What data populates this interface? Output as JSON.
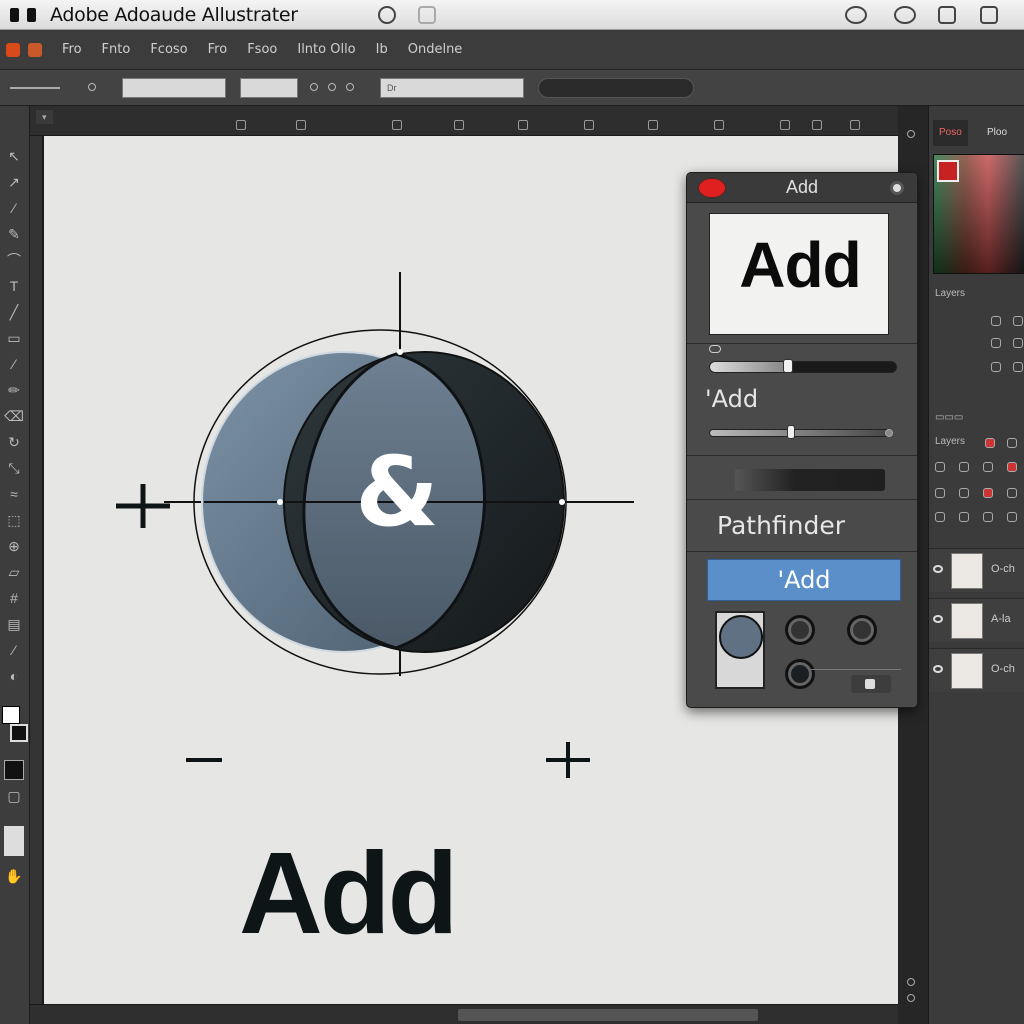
{
  "window": {
    "title": "Adobe Adoaude Allustrater"
  },
  "menu": {
    "items": [
      "Fro",
      "Fnto",
      "Fcoso",
      "Fro",
      "Fsoo",
      "Ilnto Ollo",
      "Ib",
      "Ondelne"
    ]
  },
  "controlbar": {
    "field_1": "",
    "field_2": "",
    "field_3": "Dr"
  },
  "canvas": {
    "ampersand": "&",
    "label": "Add",
    "minus": "-",
    "plus": "+"
  },
  "pathfinder_panel": {
    "title": "Add",
    "preview_text": "Add",
    "option_label": "'Add",
    "section_title": "Pathfinder",
    "add_button_label": "'Add"
  },
  "dock": {
    "tabs": [
      "Poso",
      "Ploo"
    ],
    "section_1_label": "Layers",
    "section_2_label": "Layers",
    "layers": [
      {
        "name": "O-ch"
      },
      {
        "name": "A-la"
      },
      {
        "name": "O-ch"
      }
    ]
  },
  "statusbar": {
    "zoom": "",
    "doc": ""
  },
  "colors": {
    "accent": "#5a8fc9",
    "close_button": "#e02020",
    "circle_left": "#6b7f92",
    "circle_center": "#56687a",
    "circle_right": "#1e2528",
    "canvas_bg": "#e6e6e4"
  }
}
